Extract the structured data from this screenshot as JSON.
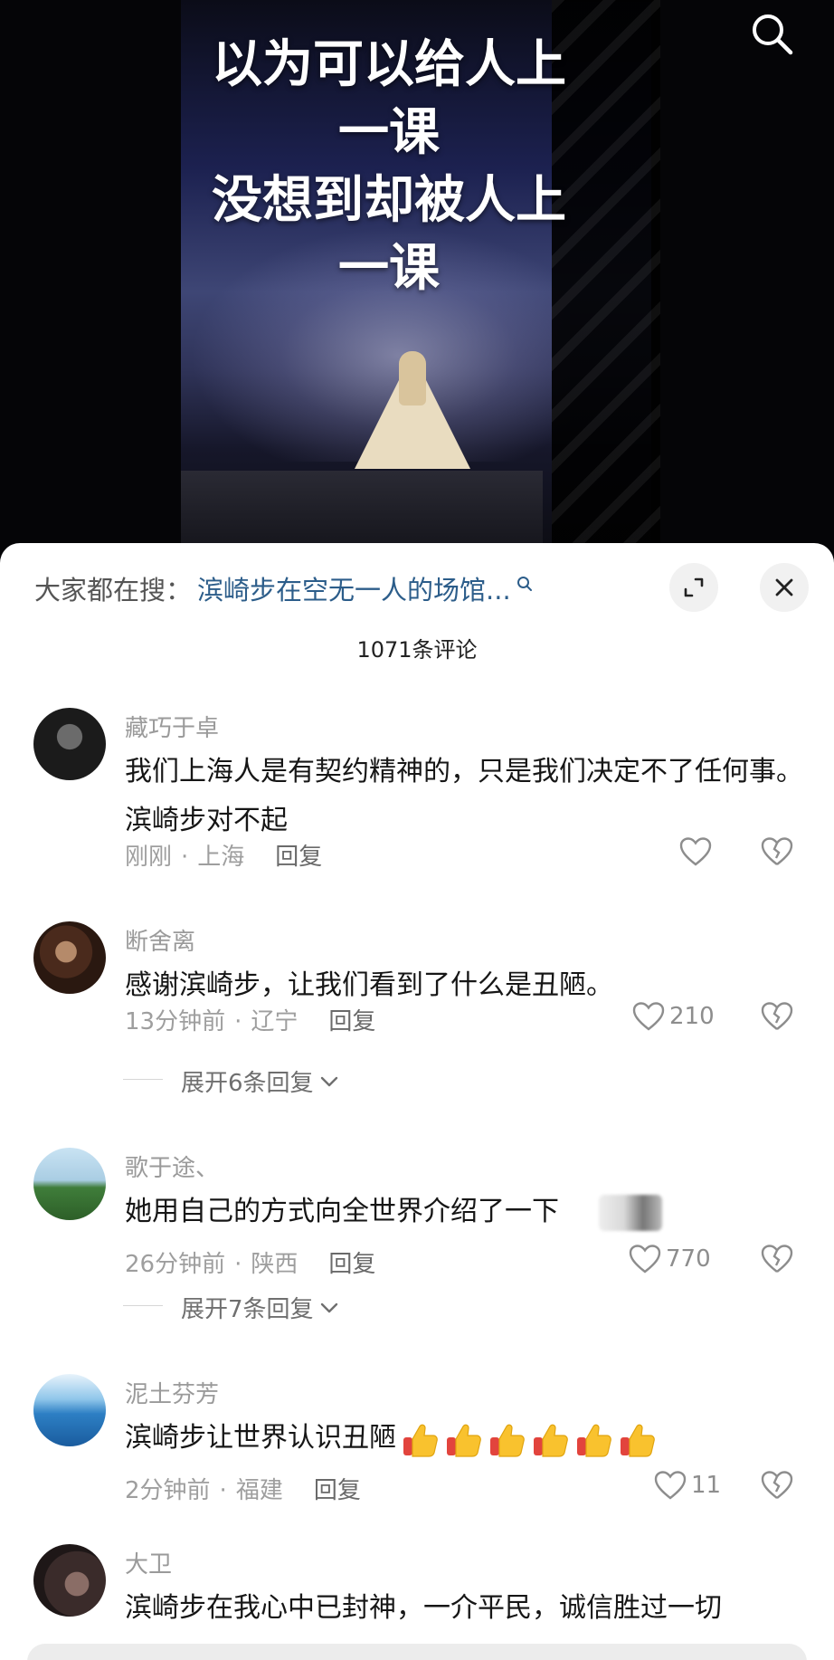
{
  "video": {
    "overlay_lines": [
      "以为可以给人上",
      "一课",
      "没想到却被人上",
      "一课"
    ]
  },
  "sheet": {
    "search_prefix": "大家都在搜：",
    "search_query": "滨崎步在空无一人的场馆...",
    "comment_count": "1071条评论"
  },
  "comments": [
    {
      "username": "藏巧于卓",
      "text": "我们上海人是有契约精神的，只是我们决定不了任何事。滨崎步对不起",
      "time": "刚刚",
      "location": "上海",
      "reply_label": "回复",
      "likes": ""
    },
    {
      "username": "断舍离",
      "text": "感谢滨崎步，让我们看到了什么是丑陋。",
      "time": "13分钟前",
      "location": "辽宁",
      "reply_label": "回复",
      "likes": "210",
      "expand_label": "展开6条回复"
    },
    {
      "username": "歌于途、",
      "text": "她用自己的方式向全世界介绍了一下",
      "time": "26分钟前",
      "location": "陕西",
      "reply_label": "回复",
      "likes": "770",
      "expand_label": "展开7条回复"
    },
    {
      "username": "泥土芬芳",
      "text": "滨崎步让世界认识丑陋",
      "time": "2分钟前",
      "location": "福建",
      "reply_label": "回复",
      "likes": "11",
      "emoji": "thumbs-up-icon",
      "emoji_count": 6
    },
    {
      "username": "大卫",
      "text": "滨崎步在我心中已封神，一介平民，诚信胜过一切"
    }
  ],
  "colors": {
    "accent_link": "#2c5d8a",
    "meta_gray": "#9e9e9e",
    "text": "#161616"
  }
}
